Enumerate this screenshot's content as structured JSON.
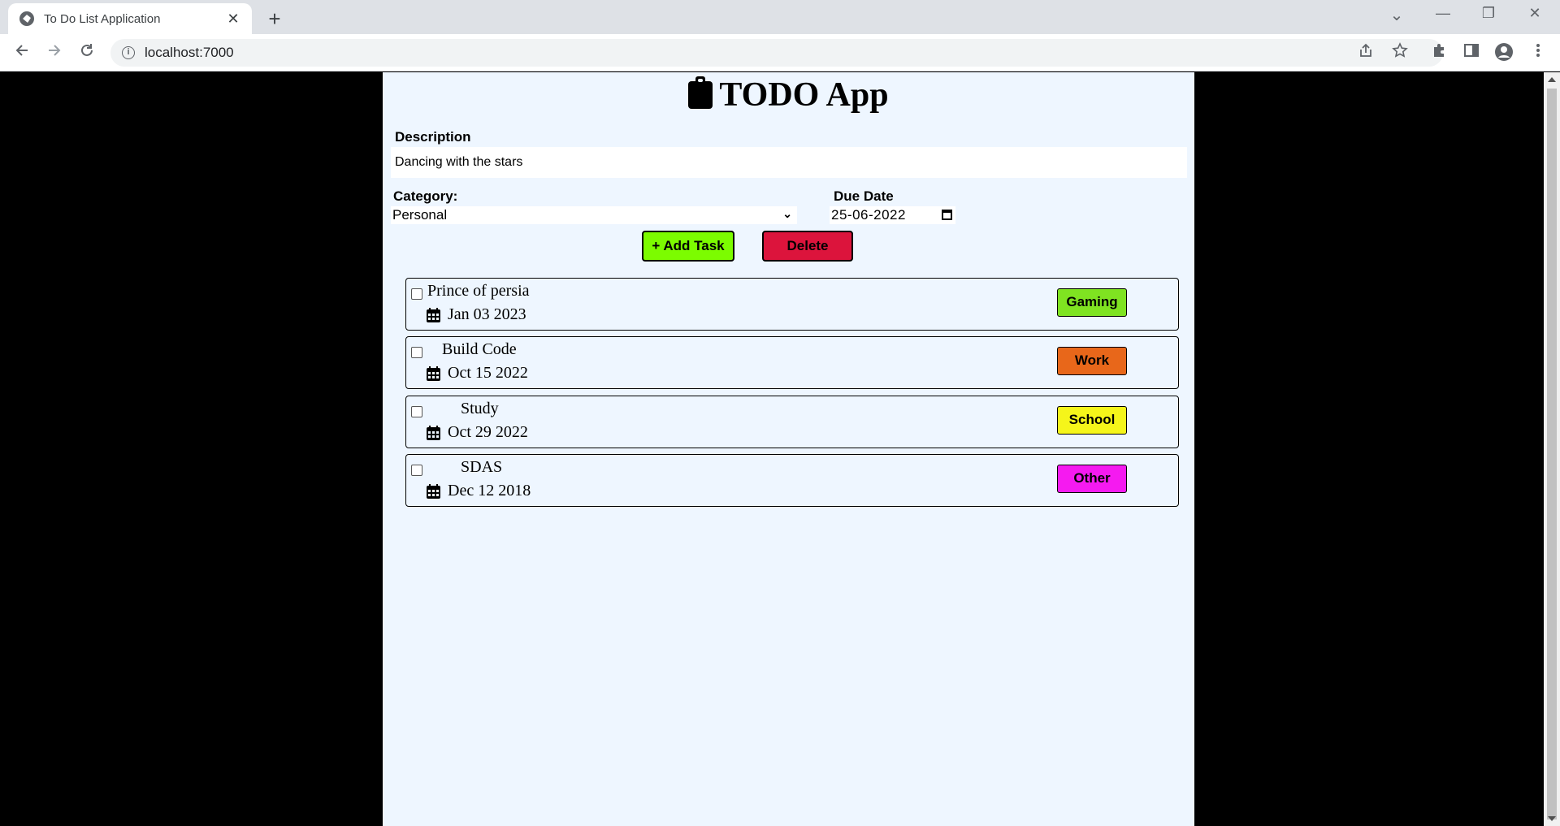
{
  "browser": {
    "tab_title": "To Do List Application",
    "tab_close": "✕",
    "new_tab": "+",
    "url": "localhost:7000",
    "window_controls": {
      "minimize": "—",
      "restore": "❐",
      "close": "✕",
      "tablist": "⌄"
    }
  },
  "app": {
    "title": "TODO App",
    "description_label": "Description",
    "description_value": "Dancing with the stars",
    "category_label": "Category:",
    "category_value": "Personal",
    "due_date_label": "Due Date",
    "due_date_value": "25-06-2022",
    "add_button": "+ Add Task",
    "delete_button": "Delete"
  },
  "tasks": [
    {
      "name": "Prince of persia",
      "date": "Jan 03 2023",
      "category": "Gaming",
      "color": "#7fe321"
    },
    {
      "name": "Build Code",
      "date": "Oct 15 2022",
      "category": "Work",
      "color": "#e8671a"
    },
    {
      "name": "Study",
      "date": "Oct 29 2022",
      "category": "School",
      "color": "#f5f51a"
    },
    {
      "name": "SDAS",
      "date": "Dec 12 2018",
      "category": "Other",
      "color": "#f51af0"
    }
  ]
}
